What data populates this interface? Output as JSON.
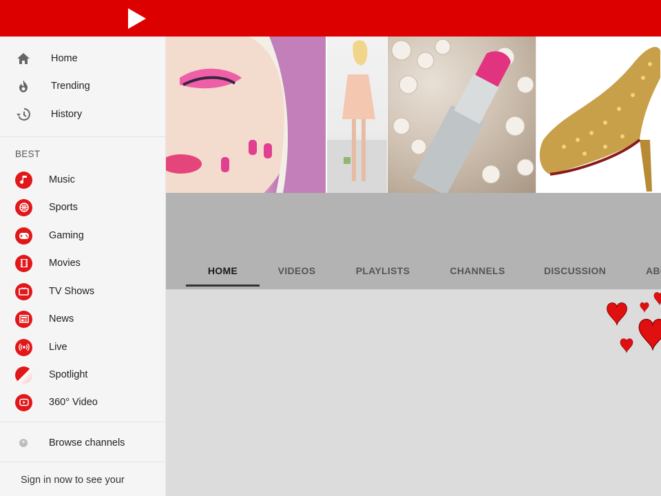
{
  "brand": {
    "accent": "#dd0000",
    "logo_icon": "play-icon"
  },
  "sidebar": {
    "main_items": [
      {
        "label": "Home",
        "icon": "home-icon"
      },
      {
        "label": "Trending",
        "icon": "flame-icon"
      },
      {
        "label": "History",
        "icon": "history-icon"
      }
    ],
    "section_title": "BEST",
    "categories": [
      {
        "label": "Music",
        "icon": "music-note-icon"
      },
      {
        "label": "Sports",
        "icon": "basketball-icon"
      },
      {
        "label": "Gaming",
        "icon": "gamepad-icon"
      },
      {
        "label": "Movies",
        "icon": "film-icon"
      },
      {
        "label": "TV Shows",
        "icon": "tv-icon"
      },
      {
        "label": "News",
        "icon": "newspaper-icon"
      },
      {
        "label": "Live",
        "icon": "live-broadcast-icon"
      },
      {
        "label": "Spotlight",
        "icon": "spotlight-icon"
      },
      {
        "label": "360° Video",
        "icon": "360-video-icon"
      }
    ],
    "browse_label": "Browse channels",
    "signin_text": "Sign in now to see your"
  },
  "channel": {
    "tabs": [
      {
        "label": "HOME",
        "active": true
      },
      {
        "label": "VIDEOS",
        "active": false
      },
      {
        "label": "PLAYLISTS",
        "active": false
      },
      {
        "label": "CHANNELS",
        "active": false
      },
      {
        "label": "DISCUSSION",
        "active": false
      },
      {
        "label": "ABO",
        "active": false
      }
    ]
  }
}
